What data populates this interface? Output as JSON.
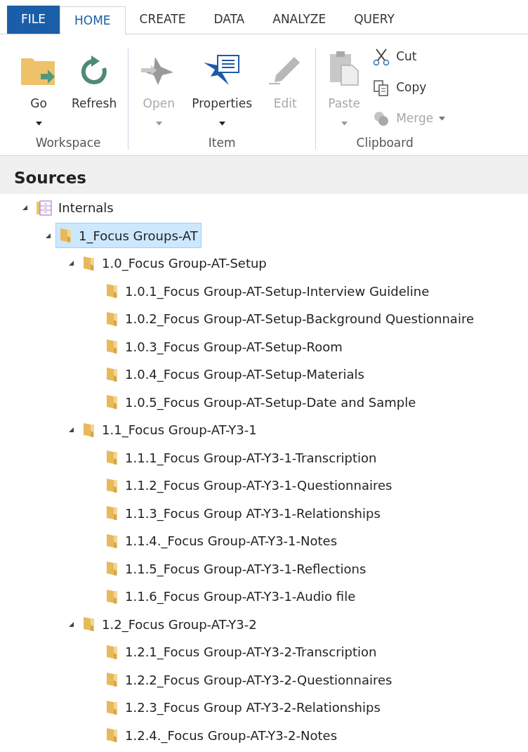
{
  "ribbon": {
    "tabs": [
      {
        "label": "FILE",
        "kind": "file",
        "selected": false
      },
      {
        "label": "HOME",
        "kind": "tab",
        "selected": true
      },
      {
        "label": "CREATE",
        "kind": "tab",
        "selected": false
      },
      {
        "label": "DATA",
        "kind": "tab",
        "selected": false
      },
      {
        "label": "ANALYZE",
        "kind": "tab",
        "selected": false
      },
      {
        "label": "QUERY",
        "kind": "tab",
        "selected": false
      }
    ],
    "groups": [
      {
        "label": "Workspace",
        "buttons": [
          {
            "label": "Go",
            "kind": "go",
            "disabled": false,
            "dropdown": true
          },
          {
            "label": "Refresh",
            "kind": "refresh",
            "disabled": false,
            "dropdown": false
          }
        ]
      },
      {
        "label": "Item",
        "buttons": [
          {
            "label": "Open",
            "kind": "open",
            "disabled": true,
            "dropdown": true
          },
          {
            "label": "Properties",
            "kind": "properties",
            "disabled": false,
            "dropdown": true
          },
          {
            "label": "Edit",
            "kind": "edit",
            "disabled": true,
            "dropdown": false
          }
        ]
      },
      {
        "label": "Clipboard",
        "buttons": [
          {
            "label": "Paste",
            "kind": "paste",
            "disabled": true,
            "dropdown": true
          }
        ],
        "small_buttons": [
          {
            "label": "Cut",
            "kind": "cut",
            "disabled": false,
            "dropdown": false
          },
          {
            "label": "Copy",
            "kind": "copy",
            "disabled": false,
            "dropdown": false
          },
          {
            "label": "Merge",
            "kind": "merge",
            "disabled": true,
            "dropdown": true
          }
        ]
      }
    ]
  },
  "panel": {
    "title": "Sources",
    "tree": [
      {
        "label": "Internals",
        "kind": "internals",
        "selected": false,
        "expanded": true,
        "children": [
          {
            "label": "1_Focus Groups-AT",
            "kind": "folder",
            "selected": true,
            "expanded": true,
            "children": [
              {
                "label": "1.0_Focus Group-AT-Setup",
                "kind": "folder",
                "selected": false,
                "expanded": true,
                "children": [
                  {
                    "label": "1.0.1_Focus Group-AT-Setup-Interview Guideline",
                    "kind": "folder",
                    "selected": false
                  },
                  {
                    "label": "1.0.2_Focus Group-AT-Setup-Background Questionnaire",
                    "kind": "folder",
                    "selected": false
                  },
                  {
                    "label": "1.0.3_Focus Group-AT-Setup-Room",
                    "kind": "folder",
                    "selected": false
                  },
                  {
                    "label": "1.0.4_Focus Group-AT-Setup-Materials",
                    "kind": "folder",
                    "selected": false
                  },
                  {
                    "label": "1.0.5_Focus Group-AT-Setup-Date and Sample",
                    "kind": "folder",
                    "selected": false
                  }
                ]
              },
              {
                "label": "1.1_Focus Group-AT-Y3-1",
                "kind": "folder",
                "selected": false,
                "expanded": true,
                "children": [
                  {
                    "label": "1.1.1_Focus Group-AT-Y3-1-Transcription",
                    "kind": "folder",
                    "selected": false
                  },
                  {
                    "label": "1.1.2_Focus Group-AT-Y3-1-Questionnaires",
                    "kind": "folder",
                    "selected": false
                  },
                  {
                    "label": "1.1.3_Focus Group AT-Y3-1-Relationships",
                    "kind": "folder",
                    "selected": false
                  },
                  {
                    "label": "1.1.4._Focus Group-AT-Y3-1-Notes",
                    "kind": "folder",
                    "selected": false
                  },
                  {
                    "label": "1.1.5_Focus Group-AT-Y3-1-Reflections",
                    "kind": "folder",
                    "selected": false
                  },
                  {
                    "label": "1.1.6_Focus Group-AT-Y3-1-Audio file",
                    "kind": "folder",
                    "selected": false
                  }
                ]
              },
              {
                "label": "1.2_Focus Group-AT-Y3-2",
                "kind": "folder",
                "selected": false,
                "expanded": true,
                "children": [
                  {
                    "label": "1.2.1_Focus Group-AT-Y3-2-Transcription",
                    "kind": "folder",
                    "selected": false
                  },
                  {
                    "label": "1.2.2_Focus Group-AT-Y3-2-Questionnaires",
                    "kind": "folder",
                    "selected": false
                  },
                  {
                    "label": "1.2.3_Focus Group AT-Y3-2-Relationships",
                    "kind": "folder",
                    "selected": false
                  },
                  {
                    "label": "1.2.4._Focus Group-AT-Y3-2-Notes",
                    "kind": "folder",
                    "selected": false
                  }
                ]
              }
            ]
          }
        ]
      }
    ]
  }
}
